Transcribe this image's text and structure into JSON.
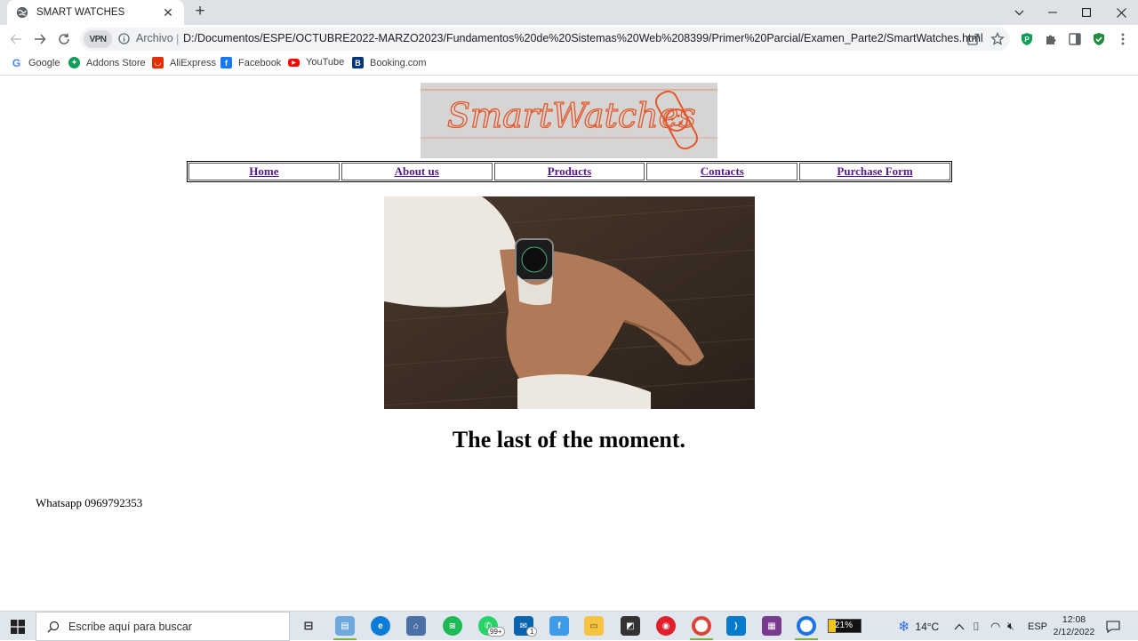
{
  "browser": {
    "tab_title": "SMART WATCHES",
    "new_tab_symbol": "+",
    "vpn_label": "VPN",
    "scheme_label": "Archivo",
    "separator": "|",
    "url": "D:/Documentos/ESPE/OCTUBRE2022-MARZO2023/Fundamentos%20de%20Sistemas%20Web%208399/Primer%20Parcial/Examen_Parte2/SmartWatches.html",
    "bookmarks": [
      {
        "label": "Google",
        "icon": "google-icon",
        "color": "#4285f4"
      },
      {
        "label": "Addons Store",
        "icon": "addons-store-icon",
        "color": "#0f9d58"
      },
      {
        "label": "AliExpress",
        "icon": "aliexpress-icon",
        "color": "#e62e04"
      },
      {
        "label": "Facebook",
        "icon": "facebook-icon",
        "color": "#1877f2"
      },
      {
        "label": "YouTube",
        "icon": "youtube-icon",
        "color": "#ff0000"
      },
      {
        "label": "Booking.com",
        "icon": "booking-icon",
        "color": "#003580"
      }
    ]
  },
  "page": {
    "logo_text": "SmartWatches",
    "nav": [
      "Home",
      "About us",
      "Products",
      "Contacts",
      "Purchase Form"
    ],
    "headline": "The last of the moment.",
    "contact": "Whatsapp 0969792353"
  },
  "taskbar": {
    "search_placeholder": "Escribe aquí para buscar",
    "whatsapp_badge": "99+",
    "mail_badge": "1",
    "battery": "21%",
    "weather": "14°C",
    "language": "ESP",
    "time": "12:08",
    "date": "2/12/2022"
  },
  "colors": {
    "link_visited": "#551a8b",
    "tabstrip": "#dee1e6",
    "taskbar": "#dfe6ee"
  }
}
